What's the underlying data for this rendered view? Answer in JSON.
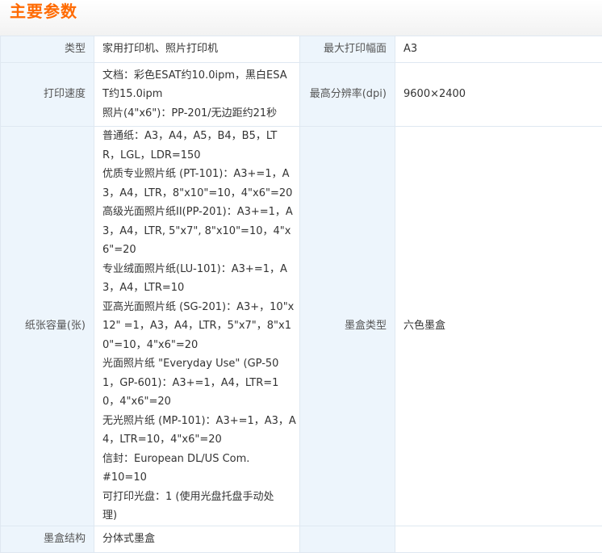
{
  "section_title": "主要参数",
  "rows": [
    {
      "label1": "类型",
      "value1_lines": [
        "家用打印机、照片打印机"
      ],
      "label2": "最大打印幅面",
      "value2": "A3"
    },
    {
      "label1": "打印速度",
      "value1_lines": [
        "文档：彩色ESAT约10.0ipm，黑白ESA",
        "T约15.0ipm",
        "照片(4\"x6\")：PP-201/无边距约21秒"
      ],
      "label2": "最高分辨率(dpi)",
      "value2": "9600×2400"
    },
    {
      "label1": "纸张容量(张)",
      "value1_lines": [
        "普通纸：A3，A4，A5，B4，B5，LT",
        "R，LGL，LDR=150",
        "优质专业照片纸 (PT-101)：A3+=1，A",
        "3，A4，LTR，8\"x10\"=10，4\"x6\"=20",
        "高级光面照片纸II(PP-201)：A3+=1，A",
        "3，A4，LTR, 5\"x7\", 8\"x10\"=10，4\"x",
        "6\"=20",
        "专业绒面照片纸(LU-101)：A3+=1，A",
        "3，A4，LTR=10",
        "亚高光面照片纸 (SG-201)：A3+，10\"x",
        "12\" =1，A3，A4，LTR，5\"x7\"，8\"x1",
        "0\"=10，4\"x6\"=20",
        "光面照片纸 \"Everyday Use\" (GP-50",
        "1，GP-601)：A3+=1，A4，LTR=1",
        "0，4\"x6\"=20",
        "无光照片纸 (MP-101)：A3+=1，A3，A",
        "4，LTR=10，4\"x6\"=20",
        "信封：European DL/US Com. #10=10",
        "可打印光盘：1 (使用光盘托盘手动处",
        "理)"
      ],
      "label2": "墨盒类型",
      "value2": "六色墨盒"
    },
    {
      "label1": "墨盒结构",
      "value1_lines": [
        "分体式墨盒"
      ],
      "label2": "",
      "value2": ""
    }
  ]
}
